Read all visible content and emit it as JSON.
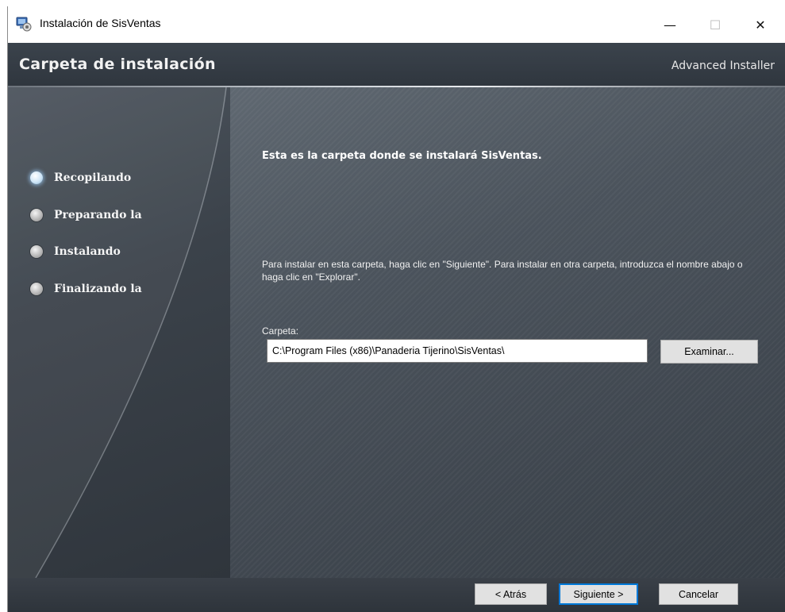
{
  "window": {
    "title": "Instalación de SisVentas",
    "controls": {
      "minimize": "—",
      "maximize": "☐",
      "close": "✕"
    }
  },
  "header": {
    "title": "Carpeta de instalación",
    "brand": "Advanced Installer"
  },
  "sidebar": {
    "steps": [
      {
        "label": "Recopilando",
        "active": true
      },
      {
        "label": "Preparando la",
        "active": false
      },
      {
        "label": "Instalando",
        "active": false
      },
      {
        "label": "Finalizando la",
        "active": false
      }
    ]
  },
  "main": {
    "heading": "Esta es la carpeta donde se instalará SisVentas.",
    "instruction": "Para instalar en esta carpeta, haga clic en \"Siguiente\". Para instalar en otra carpeta, introduzca el nombre abajo o haga clic en \"Explorar\".",
    "folder_label": "Carpeta:",
    "folder_value": "C:\\Program Files (x86)\\Panaderia Tijerino\\SisVentas\\",
    "browse_label": "Examinar..."
  },
  "footer": {
    "back_label": "< Atrás",
    "next_label": "Siguiente >",
    "cancel_label": "Cancelar"
  },
  "icons": {
    "app": "installer-icon",
    "steps": "radio-bullet-icon"
  },
  "colors": {
    "header_bg": "#353c44",
    "main_bg": "#4b535c",
    "focus_border": "#0078d7"
  }
}
